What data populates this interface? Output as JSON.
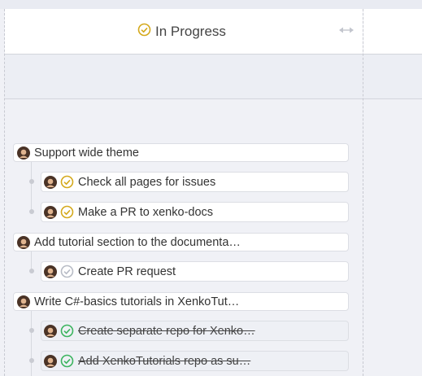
{
  "column": {
    "title": "In Progress",
    "status_icon": "check-circle-icon",
    "accent": "#d4a91c",
    "resize_icon": "resize-arrows-icon"
  },
  "colors": {
    "in_progress": "#d4a91c",
    "todo": "#b8bcc6",
    "done": "#3bb45e"
  },
  "tasks": [
    {
      "label": "Support wide theme"
    },
    {
      "label": "Check all pages for issues",
      "status": "in-progress"
    },
    {
      "label": "Make a PR to xenko-docs",
      "status": "in-progress"
    },
    {
      "label": "Add tutorial section to the documenta…"
    },
    {
      "label": "Create PR request",
      "status": "todo"
    },
    {
      "label": "Write C#-basics tutorials in XenkoTut…"
    },
    {
      "label": "Create separate repo for Xenko…",
      "status": "done"
    },
    {
      "label": "Add XenkoTutorials repo as su…",
      "status": "done"
    }
  ]
}
